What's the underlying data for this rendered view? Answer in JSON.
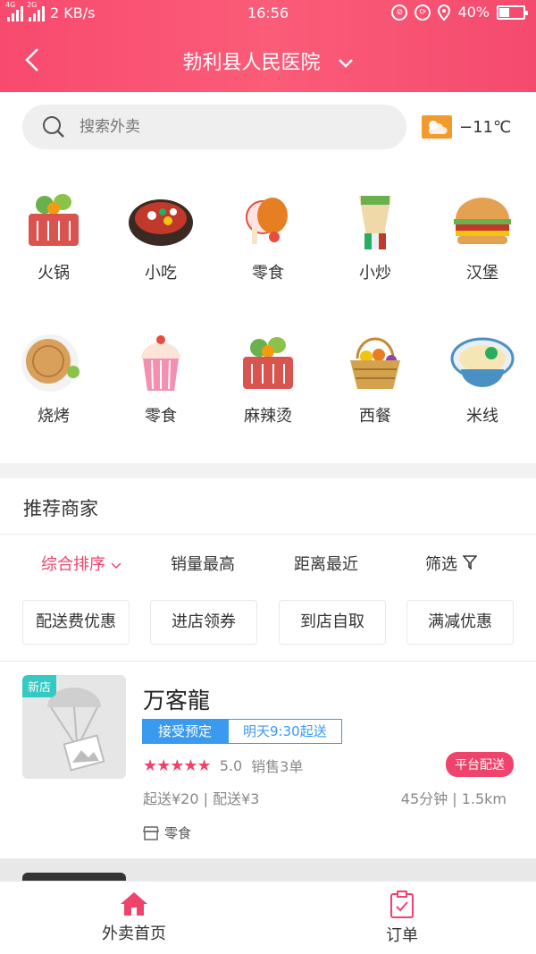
{
  "status_bar": {
    "network_speed": "2 KB/s",
    "time": "16:56",
    "battery": "40%",
    "sim1": "4G",
    "sim2": "2G"
  },
  "header": {
    "title": "勃利县人民医院"
  },
  "search": {
    "placeholder": "搜索外卖"
  },
  "weather": {
    "temperature": "−11℃",
    "icon": "partly-cloudy-icon"
  },
  "categories": [
    {
      "label": "火锅",
      "icon": "veggie-basket-icon"
    },
    {
      "label": "小吃",
      "icon": "hotpot-bowl-icon"
    },
    {
      "label": "零食",
      "icon": "meat-snack-icon"
    },
    {
      "label": "小炒",
      "icon": "wrap-icon"
    },
    {
      "label": "汉堡",
      "icon": "burger-icon"
    },
    {
      "label": "烧烤",
      "icon": "pancake-icon"
    },
    {
      "label": "零食",
      "icon": "cupcake-icon"
    },
    {
      "label": "麻辣烫",
      "icon": "veggie-basket-icon"
    },
    {
      "label": "西餐",
      "icon": "fruit-basket-icon"
    },
    {
      "label": "米线",
      "icon": "noodle-bowl-icon"
    }
  ],
  "recommend": {
    "title": "推荐商家",
    "sort_options": [
      "综合排序",
      "销量最高",
      "距离最近",
      "筛选"
    ],
    "filter_chips": [
      "配送费优惠",
      "进店领券",
      "到店自取",
      "满减优惠"
    ]
  },
  "shop": {
    "badge": "新店",
    "name": "万客龍",
    "tag_accept": "接受预定",
    "tag_delivery": "明天9:30起送",
    "rating": "5.0",
    "stars": 5,
    "sales": "销售3单",
    "platform": "平台配送",
    "fees": "起送¥20 | 配送¥3",
    "distance": "45分钟 | 1.5km",
    "category": "零食"
  },
  "tabs": [
    {
      "label": "外卖首页",
      "icon": "home-icon"
    },
    {
      "label": "订单",
      "icon": "order-clipboard-icon"
    }
  ],
  "colors": {
    "brand": "#f84a6e",
    "blue": "#3a9af0",
    "teal": "#34c9c2"
  }
}
